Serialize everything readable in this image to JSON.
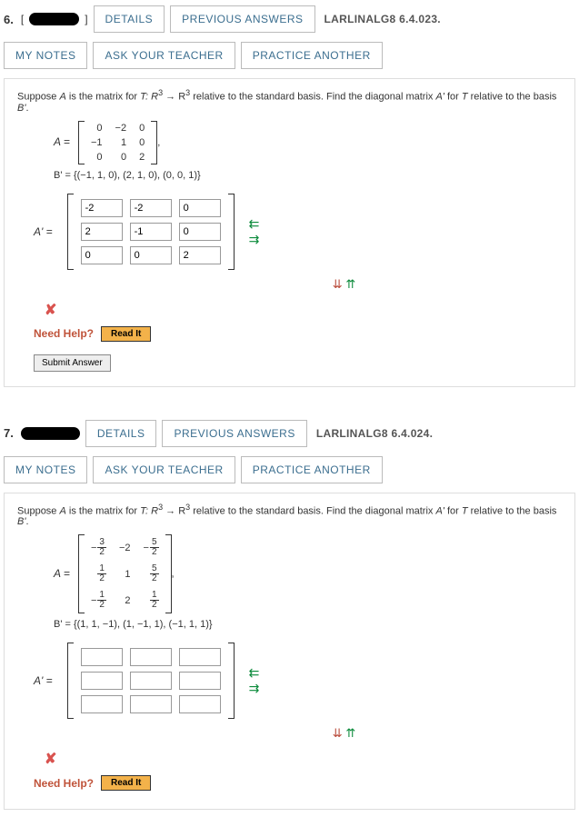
{
  "buttons": {
    "details": "DETAILS",
    "previous": "PREVIOUS ANSWERS",
    "mynotes": "MY NOTES",
    "askteacher": "ASK YOUR TEACHER",
    "practice": "PRACTICE ANOTHER",
    "readit": "Read It",
    "submit": "Submit Answer"
  },
  "needhelp_label": "Need Help?",
  "q6": {
    "number": "6.",
    "ref": "LARLINALG8 6.4.023.",
    "prompt_pre": "Suppose ",
    "prompt_mid1": " is the matrix for ",
    "prompt_T": "T: R",
    "prompt_arrow": " → R",
    "prompt_exp": "3",
    "prompt_post": " relative to the standard basis. Find the diagonal matrix ",
    "prompt_for": " for ",
    "prompt_rel": " relative to the basis ",
    "A_label": "A =",
    "A": [
      [
        "0",
        "−2",
        "0"
      ],
      [
        "−1",
        "1",
        "0"
      ],
      [
        "0",
        "0",
        "2"
      ]
    ],
    "Bprime": "B' = {(−1, 1, 0), (2, 1, 0), (0, 0, 1)}",
    "Aprime_label": "A' =",
    "inputs": [
      [
        "-2",
        "-2",
        "0"
      ],
      [
        "2",
        "-1",
        "0"
      ],
      [
        "0",
        "0",
        "2"
      ]
    ]
  },
  "q7": {
    "number": "7.",
    "ref": "LARLINALG8 6.4.024.",
    "A_label": "A =",
    "A": [
      [
        {
          "n": "3",
          "d": "2",
          "neg": true
        },
        "−2",
        {
          "n": "5",
          "d": "2",
          "neg": true
        }
      ],
      [
        {
          "n": "1",
          "d": "2",
          "neg": false
        },
        "1",
        {
          "n": "5",
          "d": "2",
          "neg": false
        }
      ],
      [
        {
          "n": "1",
          "d": "2",
          "neg": true
        },
        "2",
        {
          "n": "1",
          "d": "2",
          "neg": false
        }
      ]
    ],
    "Bprime": "B' = {(1, 1, −1), (1, −1, 1), (−1, 1, 1)}",
    "Aprime_label": "A' =",
    "inputs": [
      [
        "",
        "",
        ""
      ],
      [
        "",
        "",
        ""
      ],
      [
        "",
        "",
        ""
      ]
    ]
  }
}
